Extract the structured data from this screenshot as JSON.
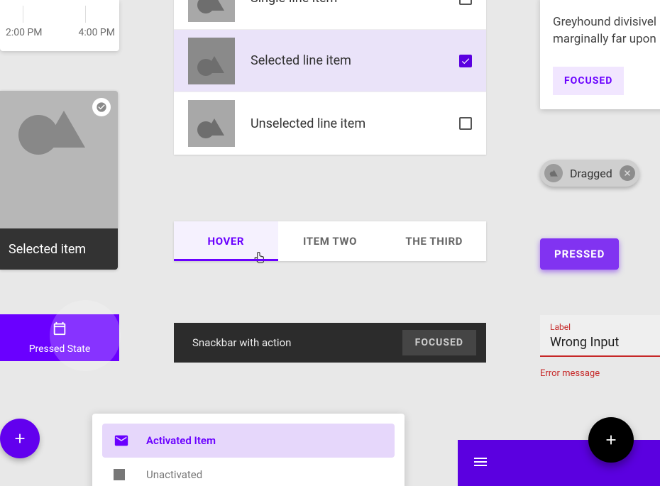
{
  "timeline": {
    "labels": [
      "2:00 PM",
      "4:00 PM"
    ]
  },
  "selected_card": {
    "title": "Selected item"
  },
  "list": {
    "items": [
      {
        "label": "Single-line item",
        "checked": false,
        "selected": false
      },
      {
        "label": "Selected line item",
        "checked": true,
        "selected": true
      },
      {
        "label": "Unselected line item",
        "checked": false,
        "selected": false
      }
    ]
  },
  "tabs": {
    "items": [
      {
        "label": "HOVER",
        "state": "hover"
      },
      {
        "label": "ITEM TWO",
        "state": "default"
      },
      {
        "label": "THE THIRD",
        "state": "default"
      }
    ]
  },
  "pressed_nav": {
    "label": "Pressed State"
  },
  "snackbar": {
    "message": "Snackbar with action",
    "action": "FOCUSED"
  },
  "drawer": {
    "items": [
      {
        "label": "Activated Item",
        "active": true
      },
      {
        "label": "Unactivated",
        "active": false
      }
    ]
  },
  "text_card": {
    "body": "Greyhound divisivel marginally far upon",
    "chip": "FOCUSED"
  },
  "chip": {
    "label": "Dragged"
  },
  "button": {
    "label": "PRESSED"
  },
  "textfield": {
    "label": "Label",
    "value": "Wrong Input",
    "error": "Error message"
  },
  "colors": {
    "primary": "#6a00ff",
    "error": "#c62828"
  }
}
